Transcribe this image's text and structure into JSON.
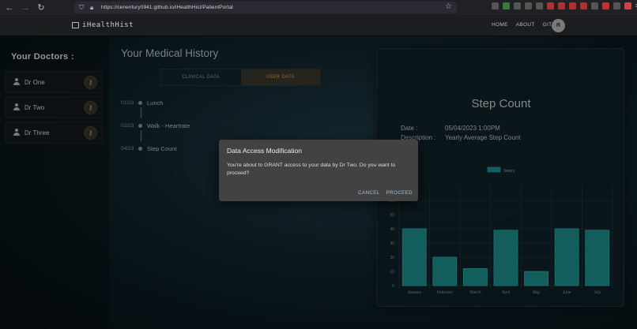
{
  "browser": {
    "url": "https://cenentury0941.github.io/iHealthHist/PatientPortal"
  },
  "header": {
    "app_name": "iHealthHist",
    "nav": [
      "HOME",
      "ABOUT",
      "GIT"
    ],
    "avatar_letter": "R"
  },
  "sidebar": {
    "title": "Your Doctors :",
    "doctors": [
      {
        "name": "Dr One"
      },
      {
        "name": "Dr Two"
      },
      {
        "name": "Dr Three"
      }
    ]
  },
  "history": {
    "title": "Your Medical History",
    "tabs": [
      {
        "label": "CLINICAL DATA",
        "active": false
      },
      {
        "label": "USER DATA",
        "active": true
      }
    ],
    "entries": [
      {
        "date": "01/23",
        "label": "Lunch"
      },
      {
        "date": "02/23",
        "label": "Walk - Heartrate"
      },
      {
        "date": "04/23",
        "label": "Step Count"
      }
    ]
  },
  "detail": {
    "title": "Step Count",
    "date_label": "Date :",
    "date_value": "05/04/2023 1:00PM",
    "desc_label": "Description :",
    "desc_value": "Yearly Average Step Count"
  },
  "chart_data": {
    "type": "bar",
    "categories": [
      "January",
      "February",
      "March",
      "April",
      "May",
      "June",
      "July"
    ],
    "series": [
      {
        "name": "Steps",
        "values": [
          40,
          20,
          12,
          39,
          10,
          40,
          39
        ]
      }
    ],
    "ylim": [
      0,
      80
    ],
    "yticks": [
      0,
      10,
      20,
      30,
      40,
      50,
      60
    ],
    "grid": true,
    "legend": "top-center",
    "bar_color": "#1e8f8f",
    "bar_border": "#2ab0b0"
  },
  "dialog": {
    "title": "Data Access Modification",
    "body": "You're about to GRANT access to your data by Dr Two. Do you want to proceed?",
    "cancel": "CANCEL",
    "proceed": "PROCEED"
  }
}
